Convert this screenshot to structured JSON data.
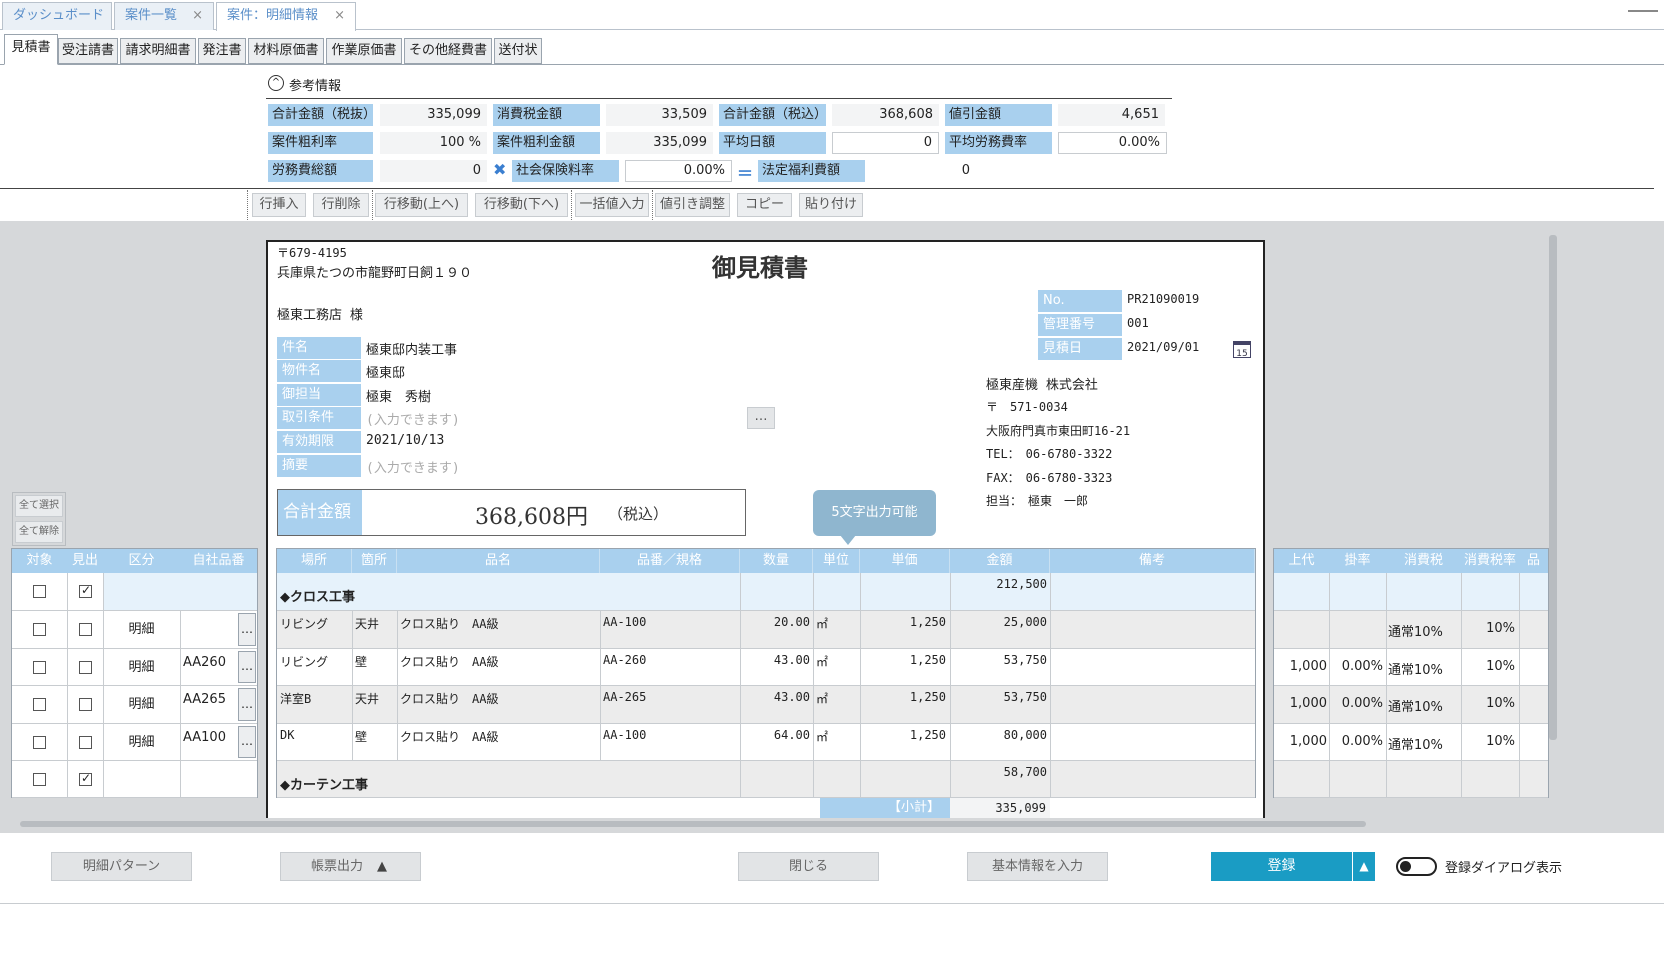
{
  "top_tabs": [
    {
      "label": "ダッシュボード"
    },
    {
      "label": "案件一覧"
    },
    {
      "label": "案件：明細情報"
    }
  ],
  "doc_tabs": [
    "見積書",
    "受注請書",
    "請求明細書",
    "発注書",
    "材料原価書",
    "作業原価書",
    "その他経費書",
    "送付状"
  ],
  "ref": {
    "title": "参考情報",
    "row1": [
      {
        "label": "合計金額（税抜）",
        "value": "335,099"
      },
      {
        "label": "消費税金額",
        "value": "33,509"
      },
      {
        "label": "合計金額（税込）",
        "value": "368,608"
      },
      {
        "label": "値引金額",
        "value": "4,651"
      }
    ],
    "row2": [
      {
        "label": "案件粗利率",
        "value": "100 %"
      },
      {
        "label": "案件粗利金額",
        "value": "335,099"
      },
      {
        "label": "平均日額",
        "value": "0"
      },
      {
        "label": "平均労務費率",
        "value": "0.00%"
      }
    ],
    "row3": [
      {
        "label": "労務費総額",
        "value": "0"
      },
      {
        "label": "社会保険料率",
        "value": "0.00%"
      },
      {
        "label": "法定福利費額",
        "value": "0"
      }
    ]
  },
  "toolbar": [
    "行挿入",
    "行削除",
    "行移動(上へ)",
    "行移動(下へ)",
    "一括値入力",
    "値引き調整",
    "コピー",
    "貼り付け"
  ],
  "side_buttons": {
    "select_all": "全て選択",
    "deselect_all": "全て解除"
  },
  "doc": {
    "postal": "〒679-4195",
    "address": "兵庫県たつの市龍野町日飼１９０",
    "title": "御見積書",
    "customer": "極東工務店 様",
    "meta": [
      {
        "label": "No.",
        "value": "PR21090019"
      },
      {
        "label": "管理番号",
        "value": "001"
      },
      {
        "label": "見積日",
        "value": "2021/09/01"
      }
    ],
    "fields": [
      {
        "label": "件名",
        "value": "極東邸内装工事",
        "placeholder": false
      },
      {
        "label": "物件名",
        "value": "極東邸",
        "placeholder": false
      },
      {
        "label": "御担当",
        "value": "極東　秀樹",
        "placeholder": false
      },
      {
        "label": "取引条件",
        "value": "(入力できます)",
        "placeholder": true
      },
      {
        "label": "有効期限",
        "value": "2021/10/13",
        "placeholder": false
      },
      {
        "label": "摘要",
        "value": "(入力できます)",
        "placeholder": true
      }
    ],
    "company": [
      "極東産機 株式会社",
      "〒　571-0034",
      "大阪府門真市東田町16-21",
      "TEL：　06-6780-3322",
      "FAX：　06-6780-3323",
      "担当：　極東　一郎"
    ],
    "total_label": "合計金額",
    "total_value": "368,608円",
    "total_suffix": "（税込）",
    "tooltip": "5文字出力可能",
    "more": "…",
    "calendar": "15"
  },
  "left_grid": {
    "headers": [
      "対象",
      "見出",
      "区分",
      "自社品番"
    ],
    "rows": [
      {
        "target": false,
        "heading": true,
        "kind": "",
        "code": "",
        "dots": false
      },
      {
        "target": false,
        "heading": false,
        "kind": "明細",
        "code": "",
        "dots": true
      },
      {
        "target": false,
        "heading": false,
        "kind": "明細",
        "code": "AA260",
        "dots": true
      },
      {
        "target": false,
        "heading": false,
        "kind": "明細",
        "code": "AA265",
        "dots": true
      },
      {
        "target": false,
        "heading": false,
        "kind": "明細",
        "code": "AA100",
        "dots": true
      },
      {
        "target": false,
        "heading": true,
        "kind": "",
        "code": "",
        "dots": false
      }
    ]
  },
  "center_grid": {
    "headers": [
      "場所",
      "箇所",
      "品名",
      "品番／規格",
      "数量",
      "単位",
      "単価",
      "金額",
      "備考"
    ],
    "rows": [
      {
        "type": "heading",
        "name": "◆クロス工事",
        "amount": "212,500"
      },
      {
        "type": "item",
        "place": "リビング",
        "spot": "天井",
        "name": "クロス貼り　AA級",
        "spec": "AA-100",
        "qty": "20.00",
        "unit": "㎡",
        "price": "1,250",
        "amount": "25,000"
      },
      {
        "type": "item",
        "place": "リビング",
        "spot": "壁",
        "name": "クロス貼り　AA級",
        "spec": "AA-260",
        "qty": "43.00",
        "unit": "㎡",
        "price": "1,250",
        "amount": "53,750"
      },
      {
        "type": "item",
        "place": "洋室B",
        "spot": "天井",
        "name": "クロス貼り　AA級",
        "spec": "AA-265",
        "qty": "43.00",
        "unit": "㎡",
        "price": "1,250",
        "amount": "53,750"
      },
      {
        "type": "item",
        "place": "DK",
        "spot": "壁",
        "name": "クロス貼り　AA級",
        "spec": "AA-100",
        "qty": "64.00",
        "unit": "㎡",
        "price": "1,250",
        "amount": "80,000"
      },
      {
        "type": "heading",
        "name": "◆カーテン工事",
        "amount": "58,700"
      }
    ],
    "subtotal_label": "【小計】",
    "subtotal_value": "335,099"
  },
  "right_grid": {
    "headers": [
      "上代",
      "掛率",
      "消費税",
      "消費税率",
      "品"
    ],
    "rows": [
      {
        "list": "",
        "rate": "",
        "tax": "",
        "taxrate": ""
      },
      {
        "list": "",
        "rate": "",
        "tax": "通常10%",
        "taxrate": "10%"
      },
      {
        "list": "1,000",
        "rate": "0.00%",
        "tax": "通常10%",
        "taxrate": "10%"
      },
      {
        "list": "1,000",
        "rate": "0.00%",
        "tax": "通常10%",
        "taxrate": "10%"
      },
      {
        "list": "1,000",
        "rate": "0.00%",
        "tax": "通常10%",
        "taxrate": "10%"
      },
      {
        "list": "",
        "rate": "",
        "tax": "",
        "taxrate": ""
      }
    ]
  },
  "bottom": {
    "pattern": "明細パターン",
    "print": "帳票出力",
    "print_arrow": "▲",
    "close": "閉じる",
    "basic": "基本情報を入力",
    "register": "登録",
    "register_arrow": "▲",
    "dialog_toggle": "登録ダイアログ表示"
  },
  "colors": {
    "header_blue": "#a9d0ee",
    "accent": "#1a9cc4",
    "tab_text": "#5b8fc9"
  }
}
